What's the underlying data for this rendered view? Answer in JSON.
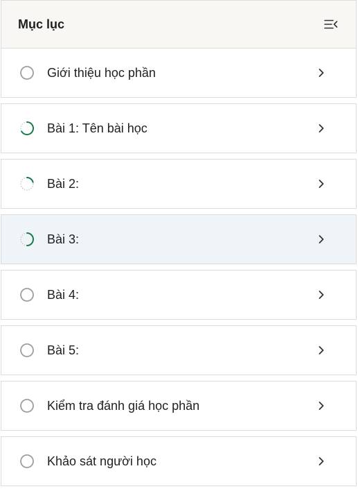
{
  "toc": {
    "title": "Mục lục",
    "items": [
      {
        "label": "Giới thiệu học phần",
        "status": "not-started",
        "active": false
      },
      {
        "label": "Bài 1: Tên bài học",
        "status": "in-progress-high",
        "active": false
      },
      {
        "label": "Bài 2:",
        "status": "in-progress-low",
        "active": false
      },
      {
        "label": "Bài 3:",
        "status": "in-progress-mid",
        "active": true
      },
      {
        "label": "Bài 4:",
        "status": "not-started",
        "active": false
      },
      {
        "label": "Bài 5:",
        "status": "not-started",
        "active": false
      },
      {
        "label": "Kiểm tra đánh giá học phần",
        "status": "not-started",
        "active": false
      },
      {
        "label": "Khảo sát người học",
        "status": "not-started",
        "active": false
      }
    ]
  },
  "colors": {
    "progress": "#1a7a4c",
    "empty_ring": "#9e9e9e",
    "active_bg": "#eef4f8",
    "header_bg": "#f8f7f4"
  },
  "icons": {
    "collapse": "collapse-menu-icon",
    "chevron": "chevron-right-icon",
    "status": "progress-circle-icon"
  }
}
